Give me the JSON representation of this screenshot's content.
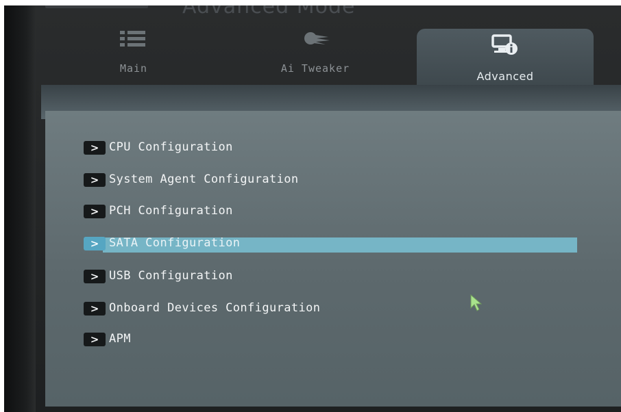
{
  "header": {
    "title": "Advanced Mode"
  },
  "tabs": [
    {
      "label": "Main",
      "icon": "list-icon",
      "active": false
    },
    {
      "label": "Ai Tweaker",
      "icon": "comet-icon",
      "active": false
    },
    {
      "label": "Advanced",
      "icon": "monitor-info-icon",
      "active": true
    }
  ],
  "menu": {
    "items": [
      {
        "label": "CPU Configuration",
        "arrow": ">"
      },
      {
        "label": "System Agent Configuration",
        "arrow": ">"
      },
      {
        "label": "PCH Configuration",
        "arrow": ">"
      },
      {
        "label": "SATA Configuration",
        "arrow": ">",
        "selected": true
      },
      {
        "label": "USB Configuration",
        "arrow": ">"
      },
      {
        "label": "Onboard Devices Configuration",
        "arrow": ">"
      },
      {
        "label": "APM",
        "arrow": ">"
      }
    ]
  },
  "colors": {
    "selection": "#76b5c6",
    "arrow_box": "#16191a",
    "arrow_box_selected": "#56a6c2",
    "cursor": "#a9e28c"
  }
}
